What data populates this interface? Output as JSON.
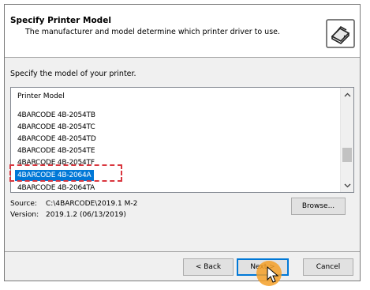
{
  "header": {
    "title": "Specify Printer Model",
    "subtitle": "The manufacturer and model determine which printer driver to use."
  },
  "prompt": "Specify the model of your printer.",
  "list": {
    "column_header": "Printer Model",
    "items": [
      "4BARCODE 4B-2054TB",
      "4BARCODE 4B-2054TC",
      "4BARCODE 4B-2054TD",
      "4BARCODE 4B-2054TE",
      "4BARCODE 4B-2054TF",
      "4BARCODE 4B-2064A",
      "4BARCODE 4B-2064TA"
    ],
    "selected_index": 5
  },
  "info": {
    "source_label": "Source:",
    "source_value": "C:\\4BARCODE\\2019.1 M-2",
    "version_label": "Version:",
    "version_value": "2019.1.2 (06/13/2019)"
  },
  "buttons": {
    "browse": "Browse...",
    "back": "< Back",
    "next": "Next >",
    "cancel": "Cancel"
  },
  "icons": {
    "printer": "printer-icon",
    "scroll_up": "chevron-up-icon",
    "scroll_down": "chevron-down-icon",
    "cursor": "mouse-pointer-icon"
  },
  "colors": {
    "selection": "#0078d7",
    "annotation": "#d9363e",
    "cursor_highlight": "#f5a028"
  }
}
